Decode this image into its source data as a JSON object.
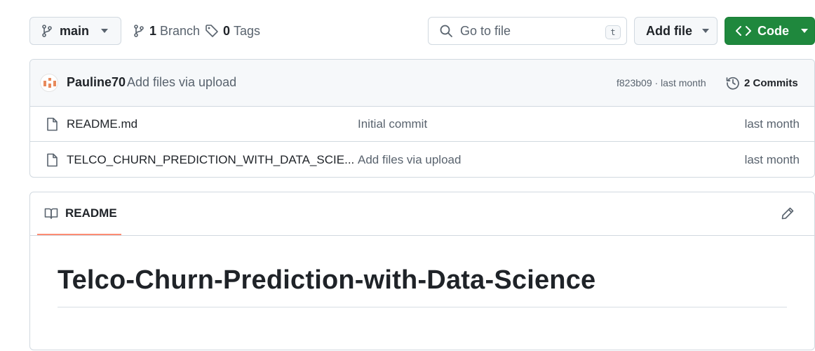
{
  "toolbar": {
    "branch_name": "main",
    "branches_count": "1",
    "branches_label": "Branch",
    "tags_count": "0",
    "tags_label": "Tags",
    "search_placeholder": "Go to file",
    "search_shortcut": "t",
    "add_file_label": "Add file",
    "code_label": "Code"
  },
  "commit": {
    "author": "Pauline70",
    "message": "Add files via upload",
    "meta": "f823b09 · last month",
    "commits_label": "2 Commits"
  },
  "files": [
    {
      "name": "README.md",
      "message": "Initial commit",
      "date": "last month",
      "icon": "file-icon"
    },
    {
      "name": "TELCO_CHURN_PREDICTION_WITH_DATA_SCIE...",
      "message": "Add files via upload",
      "date": "last month",
      "icon": "file-icon"
    }
  ],
  "readme": {
    "tab_label": "README",
    "title": "Telco-Churn-Prediction-with-Data-Science"
  },
  "colors": {
    "code_button": "#1f883d",
    "readme_tab_underline": "#fd8c73",
    "border": "#d1d9e0"
  }
}
